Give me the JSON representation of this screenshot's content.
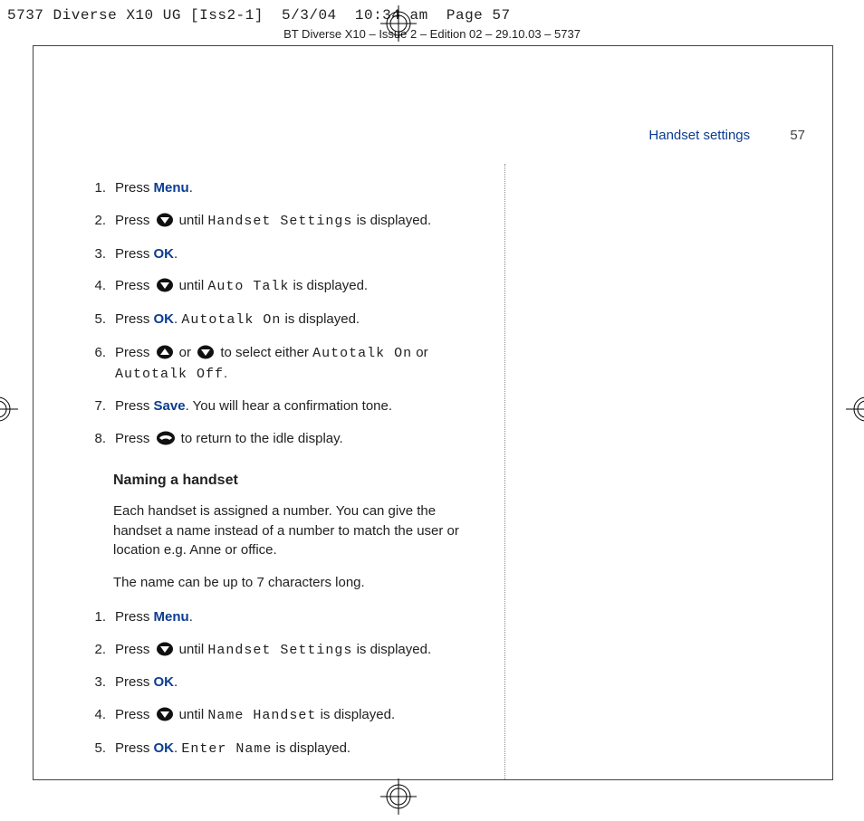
{
  "printer_header": "5737 Diverse X10 UG [Iss2-1]  5/3/04  10:34 am  Page 57",
  "edition_line": "BT Diverse X10 – Issue 2 – Edition 02 – 29.10.03 – 5737",
  "running_head": {
    "title": "Handset settings",
    "page": "57"
  },
  "steps_a": {
    "s1a": "Press ",
    "s1b": "Menu",
    "s1c": ".",
    "s2a": "Press ",
    "s2b": " until ",
    "s2c": "Handset Settings",
    "s2d": " is displayed.",
    "s3a": "Press ",
    "s3b": "OK",
    "s3c": ".",
    "s4a": "Press ",
    "s4b": " until ",
    "s4c": "Auto Talk",
    "s4d": " is displayed.",
    "s5a": "Press ",
    "s5b": "OK",
    "s5c": ". ",
    "s5d": "Autotalk On",
    "s5e": " is displayed.",
    "s6a": "Press ",
    "s6b": " or ",
    "s6c": " to select either ",
    "s6d": "Autotalk On",
    "s6e": " or ",
    "s6f": "Autotalk Off",
    "s6g": ".",
    "s7a": "Press ",
    "s7b": "Save",
    "s7c": ". You will hear a confirmation tone.",
    "s8a": "Press ",
    "s8b": " to return to the idle display."
  },
  "section_b_head": "Naming a handset",
  "section_b_p1": "Each handset is assigned a number. You can give the handset a name instead of a number to match the user or location e.g. Anne or office.",
  "section_b_p2": "The name can be up to 7 characters long.",
  "steps_b": {
    "s1a": "Press ",
    "s1b": "Menu",
    "s1c": ".",
    "s2a": "Press ",
    "s2b": " until ",
    "s2c": "Handset Settings",
    "s2d": " is displayed.",
    "s3a": "Press ",
    "s3b": "OK",
    "s3c": ".",
    "s4a": "Press ",
    "s4b": " until ",
    "s4c": "Name Handset",
    "s4d": " is displayed.",
    "s5a": "Press ",
    "s5b": "OK",
    "s5c": ". ",
    "s5d": "Enter Name",
    "s5e": " is displayed."
  }
}
